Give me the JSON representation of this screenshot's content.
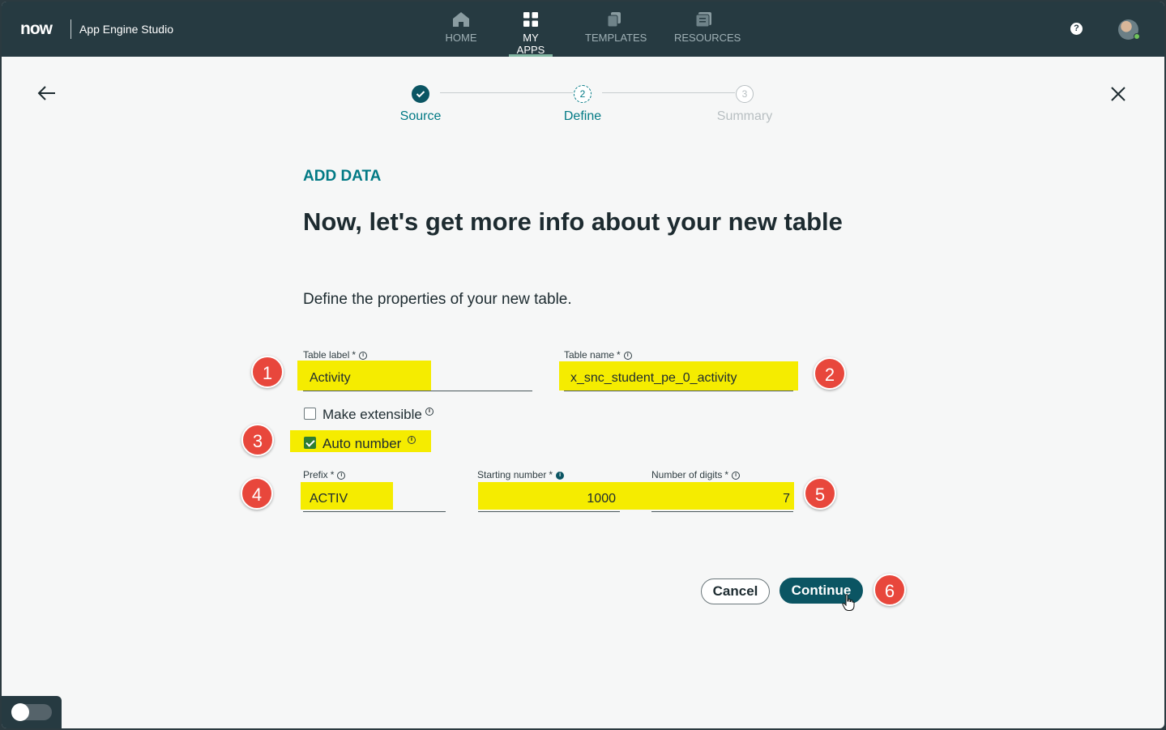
{
  "app": {
    "logo": "now",
    "name": "App Engine Studio"
  },
  "nav": [
    {
      "label": "HOME",
      "icon": "home-icon",
      "active": false
    },
    {
      "label": "MY APPS",
      "icon": "grid-icon",
      "active": true
    },
    {
      "label": "TEMPLATES",
      "icon": "templates-icon",
      "active": false
    },
    {
      "label": "RESOURCES",
      "icon": "resources-icon",
      "active": false
    }
  ],
  "header_right": {
    "help": "?",
    "avatar": "user-avatar"
  },
  "steps": [
    {
      "number": "1",
      "label": "Source",
      "state": "complete"
    },
    {
      "number": "2",
      "label": "Define",
      "state": "current"
    },
    {
      "number": "3",
      "label": "Summary",
      "state": "upcoming"
    }
  ],
  "page": {
    "eyebrow": "ADD DATA",
    "heading": "Now, let's get more info about your new table",
    "subtext": "Define the properties of your new table."
  },
  "form": {
    "table_label": {
      "label": "Table label",
      "required": "*",
      "info": "i",
      "value": "Activity"
    },
    "table_name": {
      "label": "Table name",
      "required": "*",
      "info": "i",
      "value": "x_snc_student_pe_0_activity"
    },
    "make_extensible": {
      "label": "Make extensible",
      "checked": false,
      "info": "i"
    },
    "auto_number": {
      "label": "Auto number",
      "checked": true,
      "info": "i"
    },
    "prefix": {
      "label": "Prefix",
      "required": "*",
      "info": "i",
      "value": "ACTIV"
    },
    "starting_number": {
      "label": "Starting number",
      "required": "*",
      "info": "i",
      "value": "1000"
    },
    "number_of_digits": {
      "label": "Number of digits",
      "required": "*",
      "info": "i",
      "value": "7"
    }
  },
  "callouts": [
    "1",
    "2",
    "3",
    "4",
    "5",
    "6"
  ],
  "actions": {
    "cancel": "Cancel",
    "continue": "Continue"
  },
  "colors": {
    "topbar": "#263a41",
    "accent": "#027a85",
    "primary_button": "#0b5563",
    "highlight": "#f5ec00",
    "callout": "#e8473c"
  }
}
